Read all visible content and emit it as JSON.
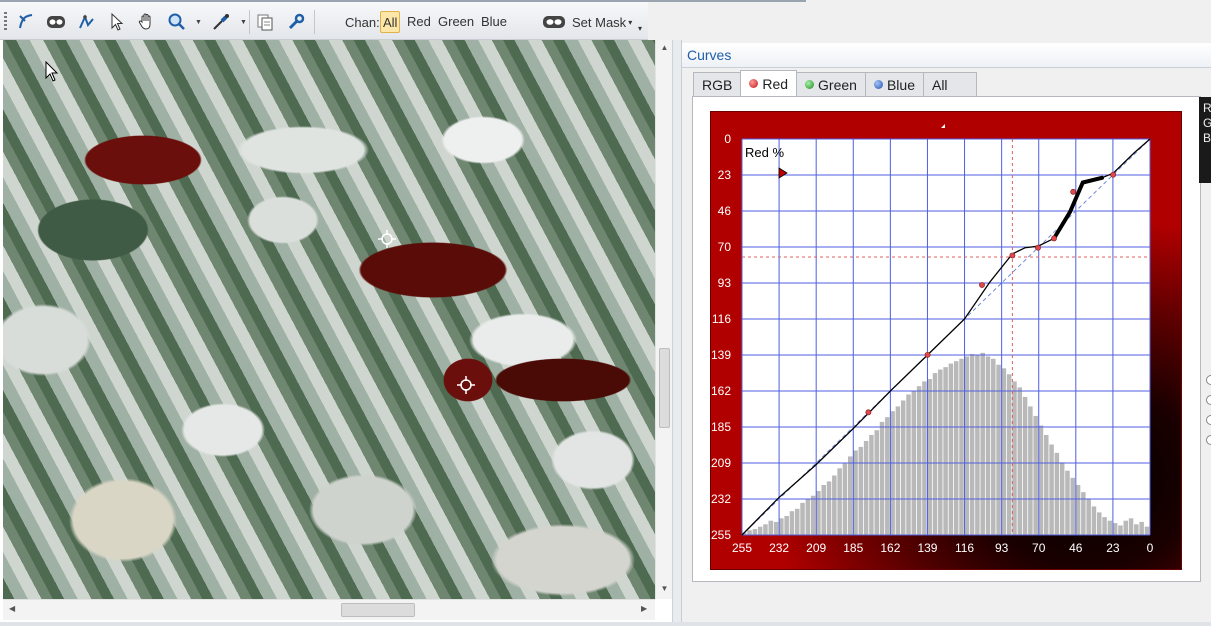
{
  "toolbar": {
    "tools": [
      "curve-tool-icon",
      "mask-view-icon",
      "pen-tool-icon",
      "pointer-icon",
      "hand-icon",
      "zoom-icon",
      "eyedropper-icon",
      "copy-icon",
      "wrench-icon"
    ],
    "chan_label": "Chan:",
    "channels": [
      "All",
      "Red",
      "Green",
      "Blue"
    ],
    "active_channel": "All",
    "set_mask_label": "Set Mask"
  },
  "panel": {
    "title": "Curves",
    "tabs": [
      {
        "label": "RGB",
        "dot_color": null
      },
      {
        "label": "Red",
        "dot_color": "#d23c3c"
      },
      {
        "label": "Green",
        "dot_color": "#3aa83a"
      },
      {
        "label": "Blue",
        "dot_color": "#3a6ed2"
      },
      {
        "label": "All",
        "dot_color": null
      }
    ],
    "active_tab": "Red",
    "side_box_lines": [
      "R",
      "G",
      "B"
    ]
  },
  "colors": {
    "accent": "#1f5fa8",
    "tab_active_highlight": "#fde7a8",
    "graph_background": "#8a0000",
    "grid_line": "#4f5fe0",
    "control_point": "#e0484c",
    "histogram": "#b9b9b9"
  },
  "chart_data": {
    "type": "line",
    "title": "Red %",
    "xlabel": "",
    "ylabel": "",
    "x_ticks": [
      "255",
      "232",
      "209",
      "185",
      "162",
      "139",
      "116",
      "93",
      "70",
      "46",
      "23",
      "0"
    ],
    "y_ticks": [
      "0",
      "23",
      "46",
      "70",
      "93",
      "116",
      "139",
      "162",
      "185",
      "209",
      "232",
      "255"
    ],
    "xlim": [
      255,
      0
    ],
    "ylim": [
      0,
      255
    ],
    "grid": true,
    "curve": {
      "name": "Red curve",
      "points": [
        [
          255,
          255
        ],
        [
          232,
          231
        ],
        [
          209,
          210
        ],
        [
          185,
          186
        ],
        [
          162,
          162
        ],
        [
          139,
          139
        ],
        [
          116,
          116
        ],
        [
          100,
          92
        ],
        [
          86,
          74
        ],
        [
          78,
          70
        ],
        [
          70,
          69
        ],
        [
          60,
          64
        ],
        [
          50,
          47
        ],
        [
          42,
          28
        ],
        [
          30,
          25
        ],
        [
          23,
          22
        ],
        [
          10,
          9
        ],
        [
          0,
          0
        ]
      ]
    },
    "control_points": [
      [
        176,
        176
      ],
      [
        139,
        139
      ],
      [
        105,
        94
      ],
      [
        86,
        75
      ],
      [
        70,
        70
      ],
      [
        60,
        64
      ],
      [
        48,
        34
      ],
      [
        23,
        23
      ]
    ],
    "crosshair": {
      "x": 86,
      "y": 76
    },
    "histogram": [
      2,
      4,
      5,
      7,
      9,
      12,
      11,
      14,
      16,
      20,
      22,
      27,
      30,
      33,
      37,
      42,
      45,
      50,
      56,
      60,
      66,
      71,
      74,
      79,
      84,
      88,
      95,
      99,
      104,
      108,
      113,
      118,
      121,
      125,
      129,
      131,
      136,
      139,
      141,
      144,
      146,
      148,
      150,
      152,
      151,
      153,
      150,
      148,
      143,
      140,
      135,
      129,
      124,
      116,
      108,
      100,
      92,
      84,
      76,
      69,
      61,
      54,
      48,
      42,
      36,
      30,
      24,
      19,
      15,
      12,
      10,
      8,
      12,
      14,
      9,
      11,
      7
    ]
  }
}
